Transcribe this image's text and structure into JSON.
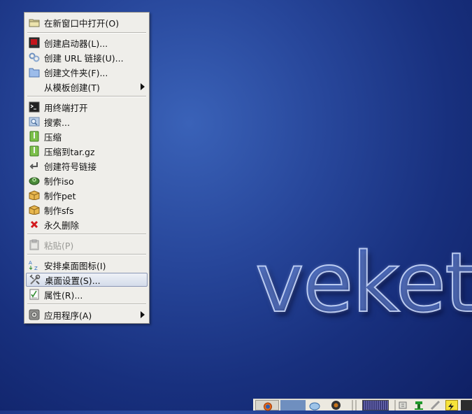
{
  "desktop": {
    "logo_text": "veket"
  },
  "menu": {
    "items": [
      {
        "label": "在新窗口中打开(O)",
        "icon": "folder-open-icon"
      },
      {
        "label": "创建启动器(L)...",
        "icon": "launcher-icon"
      },
      {
        "label": "创建 URL 链接(U)...",
        "icon": "link-icon"
      },
      {
        "label": "创建文件夹(F)...",
        "icon": "folder-icon"
      },
      {
        "label": "从模板创建(T)",
        "icon": "",
        "submenu": true
      },
      {
        "label": "用终端打开",
        "icon": "terminal-icon"
      },
      {
        "label": "搜索...",
        "icon": "search-icon"
      },
      {
        "label": "压缩",
        "icon": "archive-icon"
      },
      {
        "label": "压缩到tar.gz",
        "icon": "archive-targz-icon"
      },
      {
        "label": "创建符号链接",
        "icon": "symlink-icon"
      },
      {
        "label": "制作iso",
        "icon": "disc-icon"
      },
      {
        "label": "制作pet",
        "icon": "package-icon"
      },
      {
        "label": "制作sfs",
        "icon": "package-sfs-icon"
      },
      {
        "label": "永久删除",
        "icon": "delete-icon"
      },
      {
        "label": "粘贴(P)",
        "icon": "paste-icon",
        "disabled": true
      },
      {
        "label": "安排桌面图标(I)",
        "icon": "arrange-icon"
      },
      {
        "label": "桌面设置(S)...",
        "icon": "desktop-settings-icon",
        "active": true
      },
      {
        "label": "属性(R)...",
        "icon": "properties-icon"
      },
      {
        "label": "应用程序(A)",
        "icon": "applications-icon",
        "submenu": true
      }
    ]
  },
  "taskbar": {
    "icons": [
      "firefox-icon",
      "workspace-pager-icon",
      "network-icon",
      "media-icon",
      "cpu-graph-icon",
      "network-tray-icon",
      "battery-icon",
      "usb-icon",
      "power-icon"
    ]
  },
  "colors": {
    "desktop_bg": "#1b358a",
    "menu_bg": "#efeeea",
    "highlight_border": "#8b97b4",
    "taskbar_bg": "#ece9e0"
  }
}
